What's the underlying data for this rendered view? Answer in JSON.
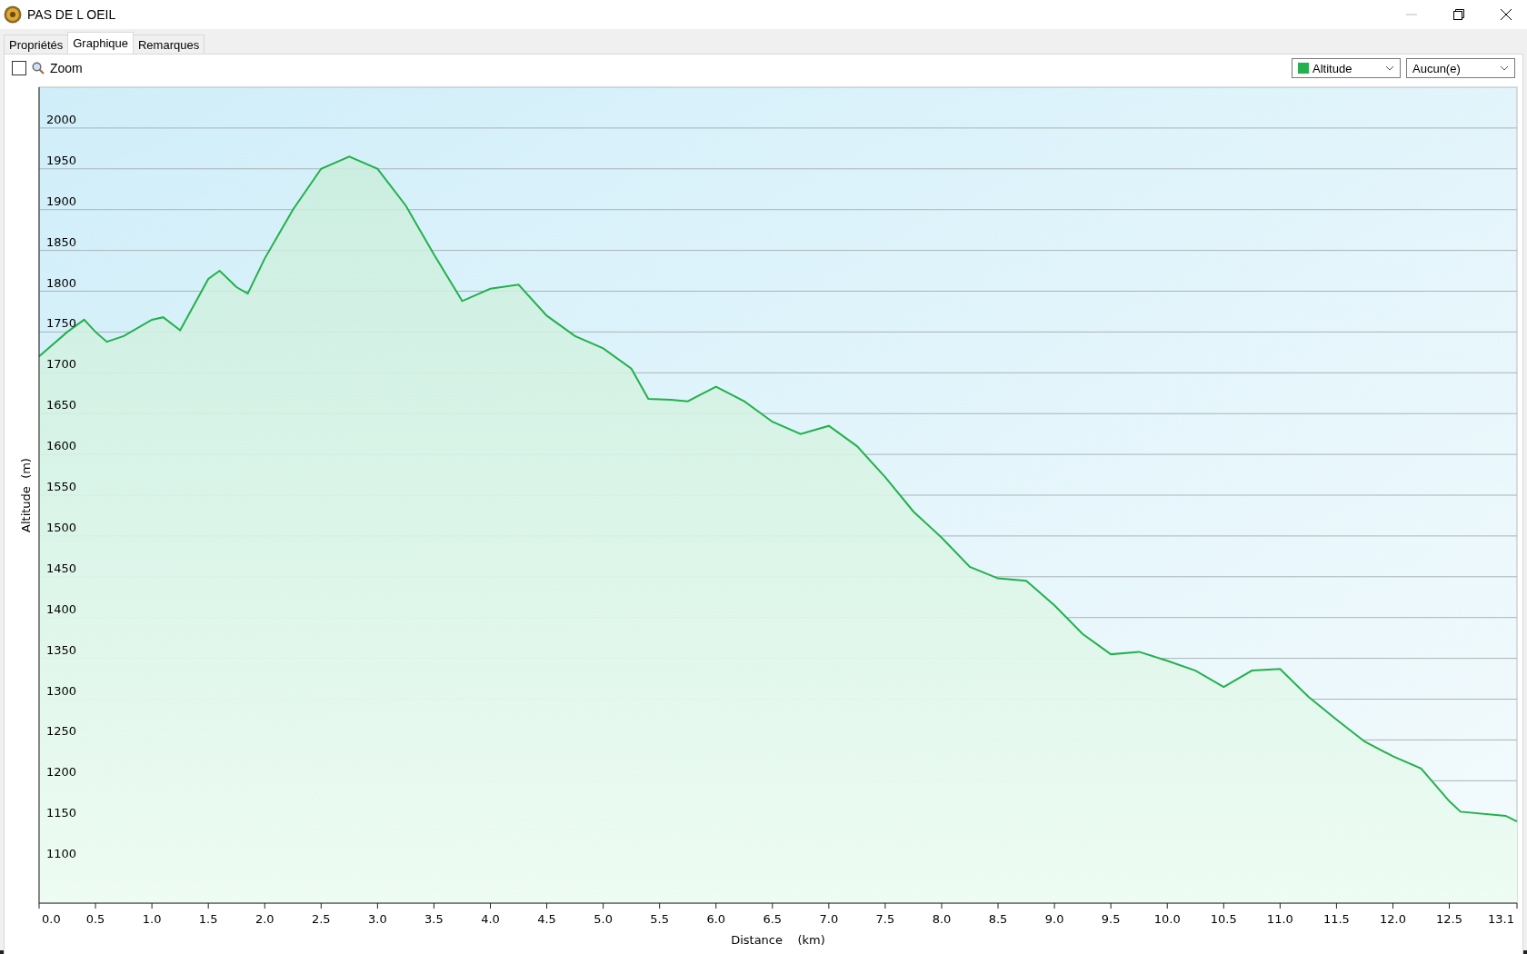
{
  "window": {
    "title": "PAS DE L OEIL"
  },
  "tabs": [
    {
      "label": "Propriétés",
      "selected": false
    },
    {
      "label": "Graphique",
      "selected": true
    },
    {
      "label": "Remarques",
      "selected": false
    }
  ],
  "toolbar": {
    "zoom": {
      "label": "Zoom",
      "checked": false
    },
    "second_select": {
      "value": "Aucun(e)"
    }
  },
  "chart": {
    "chart_data": {
      "type": "area",
      "grid": true,
      "xlabel": "Distance    (km)",
      "ylabel": "Altitude  (m)",
      "xlim": [
        0,
        13.1
      ],
      "ylim": [
        1050,
        2050
      ],
      "x": [
        0,
        0.25,
        0.4,
        0.5,
        0.6,
        0.75,
        1.0,
        1.1,
        1.25,
        1.5,
        1.6,
        1.75,
        1.85,
        2.0,
        2.25,
        2.5,
        2.75,
        3.0,
        3.25,
        3.5,
        3.75,
        4.0,
        4.25,
        4.5,
        4.75,
        5.0,
        5.25,
        5.4,
        5.6,
        5.75,
        6.0,
        6.25,
        6.5,
        6.75,
        7.0,
        7.25,
        7.5,
        7.75,
        8.0,
        8.25,
        8.5,
        8.75,
        9.0,
        9.25,
        9.5,
        9.75,
        10.0,
        10.25,
        10.5,
        10.75,
        11.0,
        11.25,
        11.5,
        11.75,
        12.0,
        12.25,
        12.5,
        12.6,
        13.0,
        13.1
      ],
      "series": [
        {
          "name": "Altitude",
          "color": "#22b14c",
          "values": [
            1720,
            1750,
            1765,
            1750,
            1738,
            1745,
            1765,
            1768,
            1752,
            1815,
            1825,
            1805,
            1797,
            1840,
            1900,
            1950,
            1965,
            1950,
            1905,
            1845,
            1788,
            1803,
            1808,
            1770,
            1745,
            1730,
            1705,
            1668,
            1667,
            1665,
            1683,
            1665,
            1640,
            1625,
            1635,
            1610,
            1572,
            1530,
            1498,
            1462,
            1448,
            1445,
            1415,
            1380,
            1355,
            1358,
            1347,
            1335,
            1315,
            1335,
            1337,
            1303,
            1275,
            1248,
            1230,
            1215,
            1175,
            1162,
            1157,
            1150
          ]
        }
      ],
      "xticks": [
        {
          "value": 0,
          "label": "0.0"
        },
        {
          "value": 0.5,
          "label": "0.5"
        },
        {
          "value": 1,
          "label": "1.0"
        },
        {
          "value": 1.5,
          "label": "1.5"
        },
        {
          "value": 2,
          "label": "2.0"
        },
        {
          "value": 2.5,
          "label": "2.5"
        },
        {
          "value": 3,
          "label": "3.0"
        },
        {
          "value": 3.5,
          "label": "3.5"
        },
        {
          "value": 4,
          "label": "4.0"
        },
        {
          "value": 4.5,
          "label": "4.5"
        },
        {
          "value": 5,
          "label": "5.0"
        },
        {
          "value": 5.5,
          "label": "5.5"
        },
        {
          "value": 6,
          "label": "6.0"
        },
        {
          "value": 6.5,
          "label": "6.5"
        },
        {
          "value": 7,
          "label": "7.0"
        },
        {
          "value": 7.5,
          "label": "7.5"
        },
        {
          "value": 8,
          "label": "8.0"
        },
        {
          "value": 8.5,
          "label": "8.5"
        },
        {
          "value": 9,
          "label": "9.0"
        },
        {
          "value": 9.5,
          "label": "9.5"
        },
        {
          "value": 10,
          "label": "10.0"
        },
        {
          "value": 10.5,
          "label": "10.5"
        },
        {
          "value": 11,
          "label": "11.0"
        },
        {
          "value": 11.5,
          "label": "11.5"
        },
        {
          "value": 12,
          "label": "12.0"
        },
        {
          "value": 12.5,
          "label": "12.5"
        },
        {
          "value": 13.1,
          "label": "13.1"
        }
      ],
      "yticks": [
        1100,
        1150,
        1200,
        1250,
        1300,
        1350,
        1400,
        1450,
        1500,
        1550,
        1600,
        1650,
        1700,
        1750,
        1800,
        1850,
        1900,
        1950,
        2000
      ]
    }
  }
}
